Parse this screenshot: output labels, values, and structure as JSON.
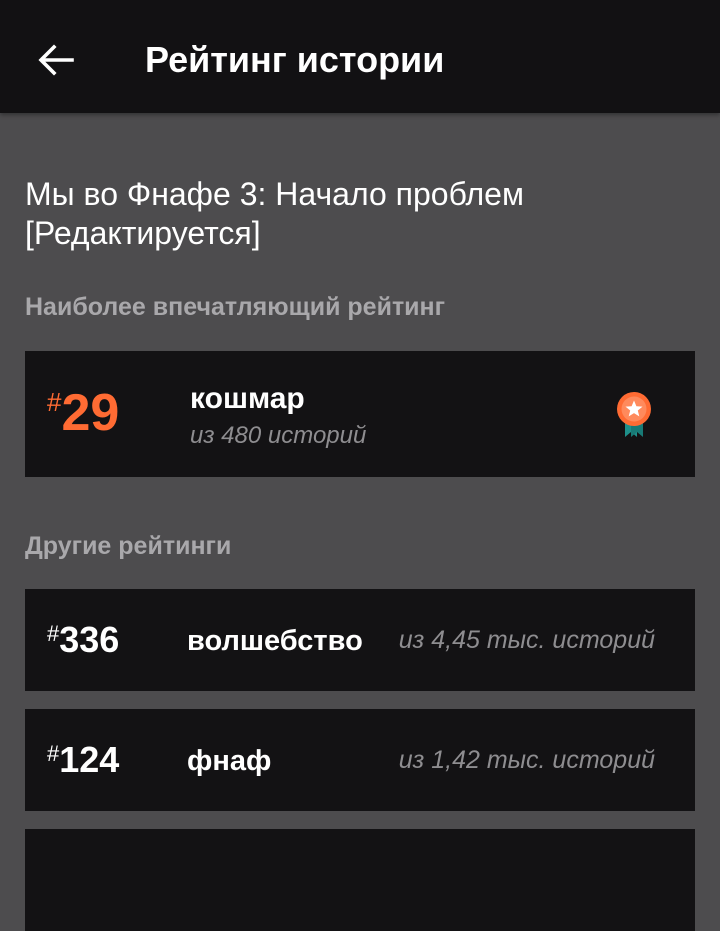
{
  "header": {
    "title": "Рейтинг истории",
    "back_icon": "arrow-left-icon"
  },
  "story": {
    "title": "Мы во Фнафе 3: Начало проблем [Редактируется]"
  },
  "top_ranking": {
    "section_label": "Наиболее впечатляющий рейтинг",
    "hash": "#",
    "rank": "29",
    "tag": "кошмар",
    "of_text": "из 480 историй",
    "badge_icon": "award-ribbon-icon",
    "accent_color": "#ff6b33",
    "badge_ribbon_color": "#1e8f8a"
  },
  "other_rankings": {
    "section_label": "Другие рейтинги",
    "items": [
      {
        "hash": "#",
        "rank": "336",
        "tag": "волшебство",
        "of_text": "из 4,45 тыс. историй"
      },
      {
        "hash": "#",
        "rank": "124",
        "tag": "фнаф",
        "of_text": "из 1,42 тыс. историй"
      }
    ]
  }
}
